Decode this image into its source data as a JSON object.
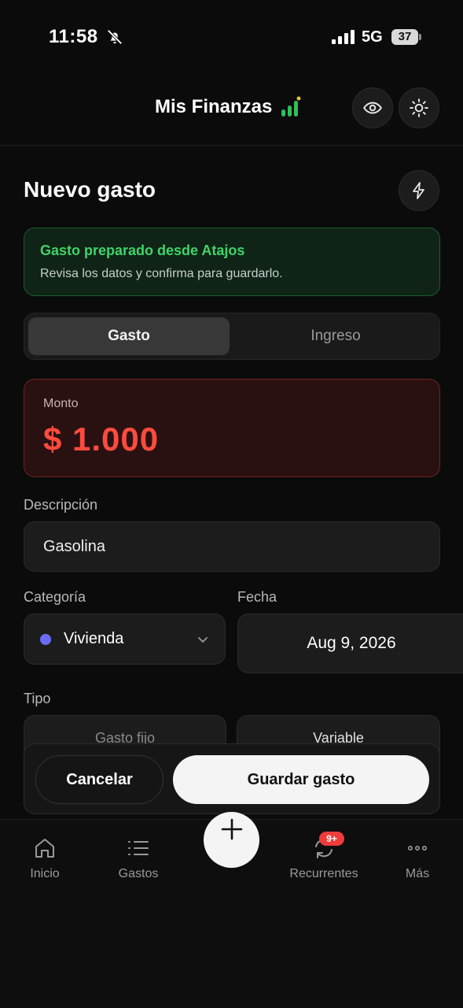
{
  "status_bar": {
    "time": "11:58",
    "network": "5G",
    "battery": "37"
  },
  "header": {
    "title": "Mis Finanzas"
  },
  "page": {
    "title": "Nuevo gasto"
  },
  "notice": {
    "title": "Gasto preparado desde Atajos",
    "text": "Revisa los datos y confirma para guardarlo."
  },
  "type_toggle": {
    "options": [
      "Gasto",
      "Ingreso"
    ],
    "selected": "Gasto"
  },
  "amount": {
    "label": "Monto",
    "value": "$ 1.000"
  },
  "description": {
    "label": "Descripción",
    "value": "Gasolina"
  },
  "category": {
    "label": "Categoría",
    "value": "Vivienda",
    "dot_color": "#6b6cf5"
  },
  "date": {
    "label": "Fecha",
    "value": "Aug 9, 2026"
  },
  "kind": {
    "label": "Tipo",
    "options": [
      "Gasto fijo",
      "Variable"
    ]
  },
  "actions": {
    "cancel": "Cancelar",
    "save": "Guardar gasto"
  },
  "nav": {
    "items": [
      "Inicio",
      "Gastos",
      "Recurrentes",
      "Más"
    ],
    "badge": "9+"
  },
  "colors": {
    "accent_red": "#ff4b3e",
    "accent_green": "#3fd46a",
    "badge": "#ef3b3b"
  }
}
